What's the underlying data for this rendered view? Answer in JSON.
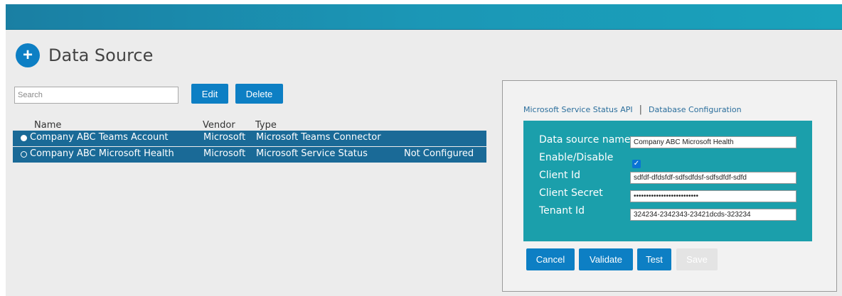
{
  "page": {
    "title": "Data Source",
    "add_icon": "+"
  },
  "toolbar": {
    "search_placeholder": "Search",
    "search_value": "",
    "edit_label": "Edit",
    "delete_label": "Delete"
  },
  "table": {
    "headers": {
      "name": "Name",
      "vendor": "Vendor",
      "type": "Type"
    },
    "rows": [
      {
        "name": "Company ABC Teams Account",
        "vendor": "Microsoft",
        "type": "Microsoft Teams Connector",
        "status": ""
      },
      {
        "name": "Company ABC Microsoft Health",
        "vendor": "Microsoft",
        "type": "Microsoft Service Status",
        "status": "Not Configured"
      }
    ]
  },
  "panel": {
    "tabs": [
      "Microsoft Service Status API",
      "Database Configuration"
    ],
    "separator": "|",
    "form": {
      "data_source_name": {
        "label": "Data source name",
        "value": "Company ABC Microsoft Health"
      },
      "enable": {
        "label": "Enable/Disable",
        "checked": true
      },
      "client_id": {
        "label": "Client Id",
        "value": "sdfdf-dfdsfdf-sdfsdfdsf-sdfsdfdf-sdfd"
      },
      "client_secret": {
        "label": "Client Secret",
        "value": "••••••••••••••••••••••••••"
      },
      "tenant_id": {
        "label": "Tenant Id",
        "value": "324234-2342343-23421dcds-323234"
      }
    },
    "actions": {
      "cancel": "Cancel",
      "validate": "Validate",
      "test": "Test",
      "save": "Save"
    }
  },
  "colors": {
    "header_bar": "#1b97b6",
    "accent": "#0d7fc4",
    "selected_row": "#1a6a97",
    "form_panel": "#1b9fab"
  }
}
